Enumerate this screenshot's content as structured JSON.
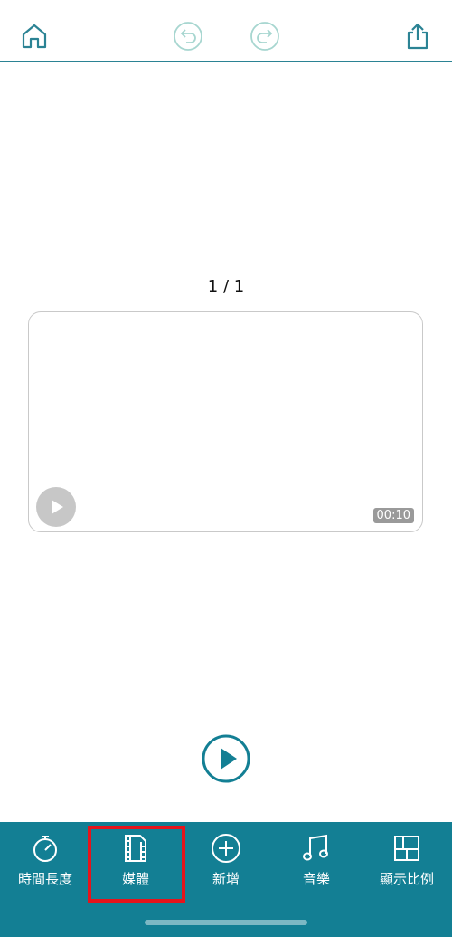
{
  "colors": {
    "accent": "#2b8394",
    "toolbar": "#137f94",
    "highlight": "#e6141b",
    "disabled": "#a7d6d0"
  },
  "header": {
    "icons": [
      "home-icon",
      "undo-icon",
      "redo-icon",
      "share-icon"
    ]
  },
  "editor": {
    "page_indicator": "1 / 1",
    "duration": "00:10"
  },
  "toolbar": {
    "items": [
      {
        "label": "時間長度",
        "icon": "stopwatch-icon"
      },
      {
        "label": "媒體",
        "icon": "film-icon"
      },
      {
        "label": "新增",
        "icon": "add-circle-icon"
      },
      {
        "label": "音樂",
        "icon": "music-note-icon"
      },
      {
        "label": "顯示比例",
        "icon": "aspect-ratio-icon"
      }
    ]
  }
}
